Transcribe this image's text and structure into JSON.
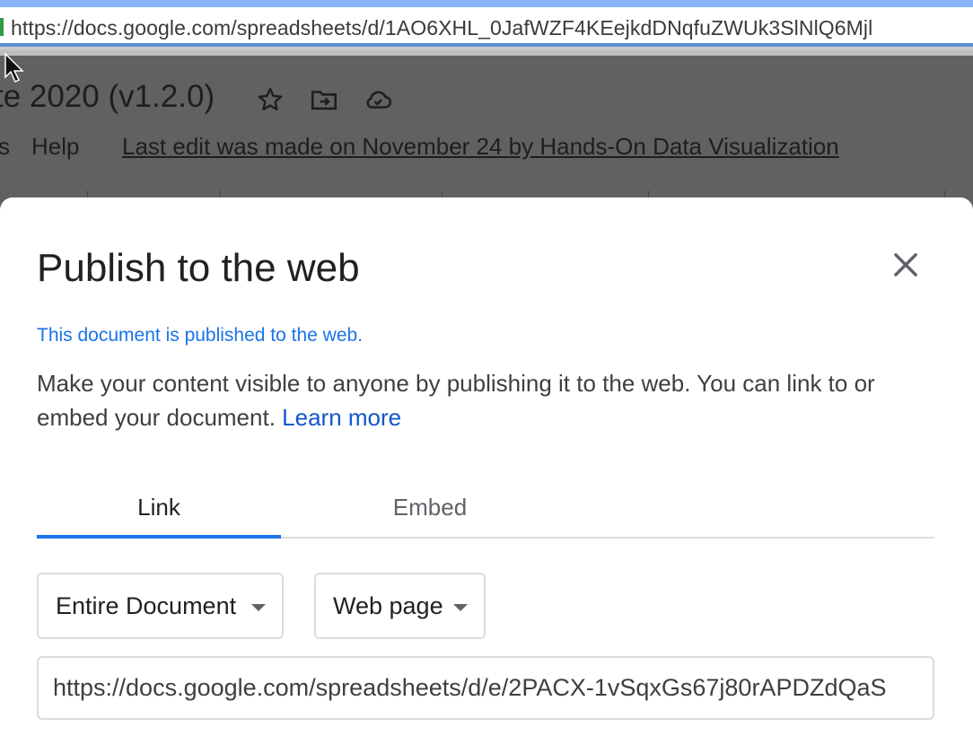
{
  "browser": {
    "url": "https://docs.google.com/spreadsheets/d/1AO6XHL_0JafWZF4KEejkdDNqfuZWUk3SlNlQ6Mjl"
  },
  "sheets": {
    "title": "te 2020 (v1.2.0)",
    "menu_partial": "s",
    "menu_help": "Help",
    "last_edit": "Last edit was made on November 24 by Hands-On Data Visualization"
  },
  "dialog": {
    "title": "Publish to the web",
    "status": "This document is published to the web.",
    "description": "Make your content visible to anyone by publishing it to the web. You can link to or embed your document.",
    "learn_more": "Learn more",
    "tabs": [
      {
        "label": "Link",
        "active": true
      },
      {
        "label": "Embed",
        "active": false
      }
    ],
    "scope_select": "Entire Document",
    "format_select": "Web page",
    "publish_url": "https://docs.google.com/spreadsheets/d/e/2PACX-1vSqxGs67j80rAPDZdQaS"
  },
  "colors": {
    "accent": "#1a73e8",
    "link": "#1155cc"
  }
}
